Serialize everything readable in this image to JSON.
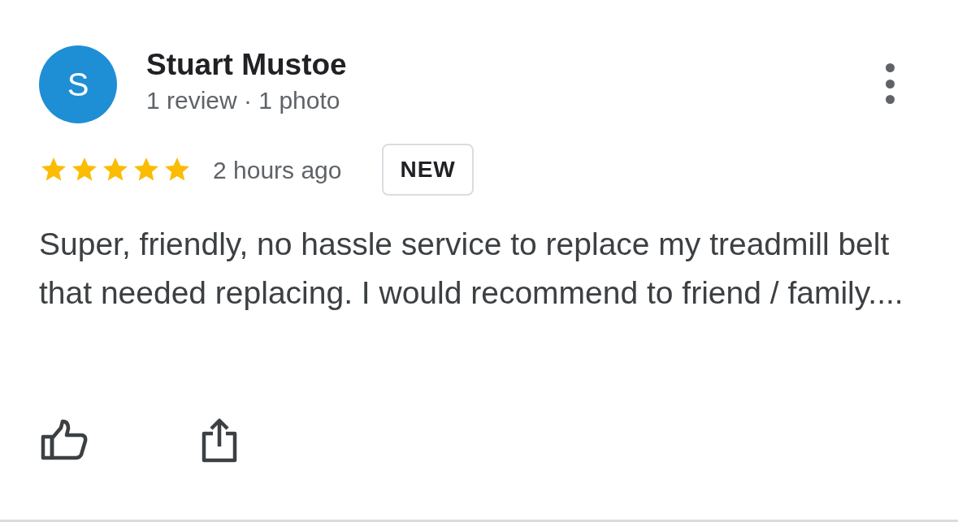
{
  "review": {
    "avatar_letter": "S",
    "color": "#1e8fd5",
    "name": "Stuart Mustoe",
    "meta": "1 review · 1 photo",
    "stars": 5,
    "time": "2 hours ago",
    "badge": "NEW",
    "text": "Super, friendly, no hassle service to replace my treadmill belt that needed replacing. I would recommend to friend / family...."
  }
}
